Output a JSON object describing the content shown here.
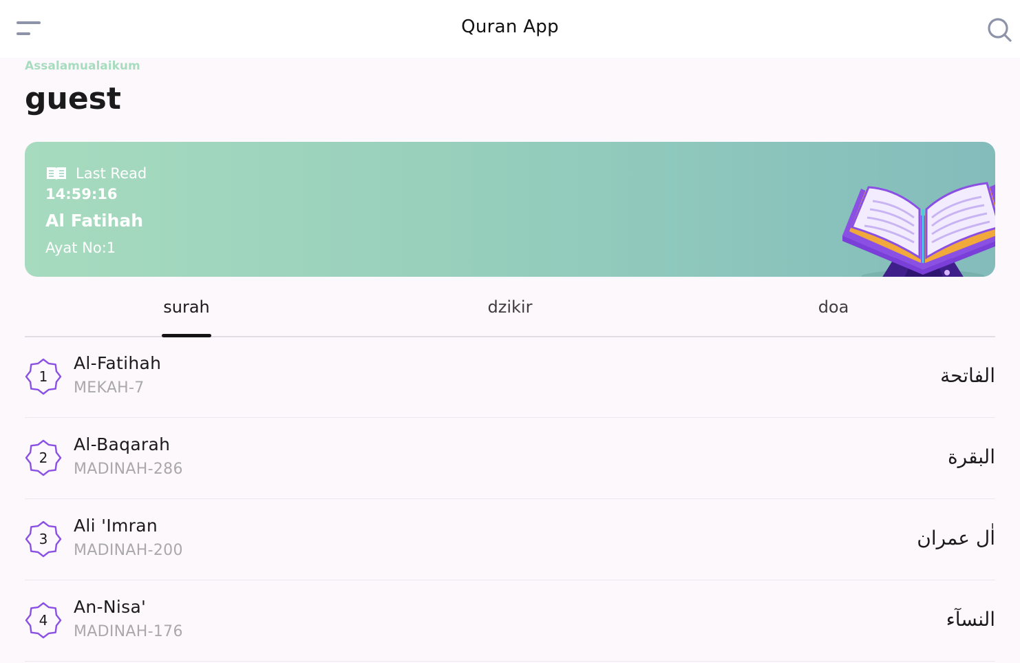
{
  "appbar": {
    "title": "Quran App",
    "menu_icon": "menu-icon",
    "search_icon": "search-icon"
  },
  "greeting": {
    "salutation": "Assalamualaikum",
    "username": "guest"
  },
  "last_read": {
    "label": "Last Read",
    "time": "14:59:16",
    "surah": "Al Fatihah",
    "ayat": "Ayat No:1",
    "icon": "book-icon",
    "illustration": "quran-on-stand-illustration"
  },
  "tabs": [
    {
      "label": "surah",
      "active": true
    },
    {
      "label": "dzikir",
      "active": false
    },
    {
      "label": "doa",
      "active": false
    }
  ],
  "surahs": [
    {
      "number": "1",
      "name": "Al-Fatihah",
      "meta": "MEKAH-7",
      "arabic": "الفاتحة"
    },
    {
      "number": "2",
      "name": "Al-Baqarah",
      "meta": "MADINAH-286",
      "arabic": "البقرة"
    },
    {
      "number": "3",
      "name": "Ali 'Imran",
      "meta": "MADINAH-200",
      "arabic": "اٰل عمران"
    },
    {
      "number": "4",
      "name": "An-Nisa'",
      "meta": "MADINAH-176",
      "arabic": "النسآء"
    }
  ],
  "colors": {
    "accent_purple": "#8a4fe3",
    "greeting_green": "#a8dcbf",
    "card_start": "#a7dbbf",
    "card_end": "#83bcbb"
  }
}
